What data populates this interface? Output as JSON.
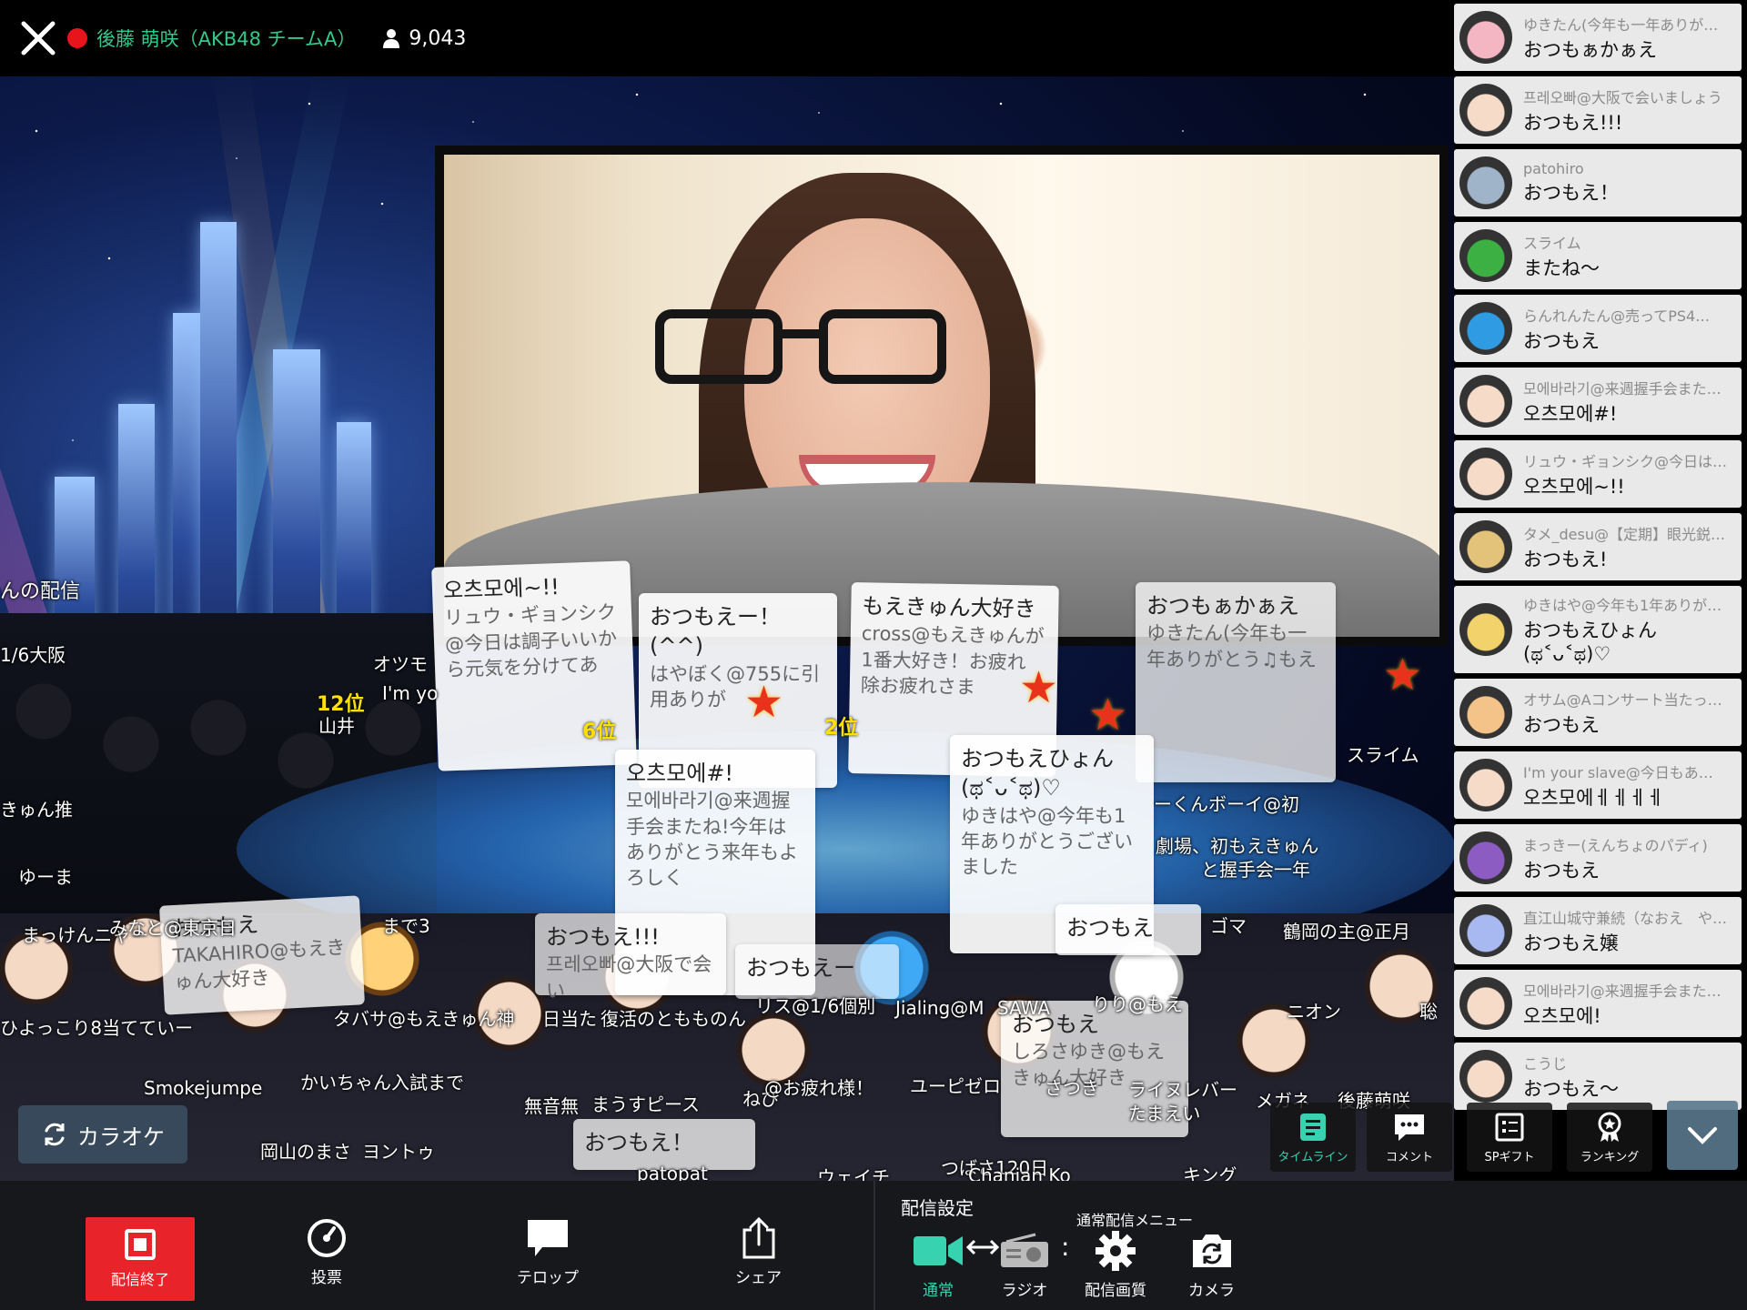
{
  "header": {
    "streamer_name": "後藤 萌咲（AKB48 チームA）",
    "viewer_count": "9,043"
  },
  "stage": {
    "cards": [
      {
        "title": "오츠모에~!!",
        "body": "リュウ・ギョンシク@今日は調子いいから元気を分けてあ"
      },
      {
        "title": "おつもえー！(^^)",
        "body": "はやぼく@755に引用ありが"
      },
      {
        "title": "もえきゅん大好き",
        "body": "cross@もえきゅんが1番大好き！お疲れ 除お疲れさま"
      },
      {
        "title": "おつもぁかぁえ",
        "body": "ゆきたん(今年も一年ありがとう♫もえ"
      },
      {
        "title": "오츠모에#!",
        "body": "모에바라기@来週握手会またね!今年はありがとう来年もよろしく"
      },
      {
        "title": "おつもえひょん(ಥ˂ᴗ˂ಥ)♡",
        "body": "ゆきはや@今年も1年ありがとうございました"
      },
      {
        "title": "おつもえ",
        "body": "TAKAHIRO@もえきゅん大好き"
      },
      {
        "title": "おつもえ!!!",
        "body": "프레오빠@大阪で会い"
      },
      {
        "title": "おつもえー",
        "body": ""
      },
      {
        "title": "おつもえ！",
        "body": ""
      },
      {
        "title": "おつもえ",
        "body": ""
      },
      {
        "title": "おつもえ",
        "body": "しろさゆき@もえきゅん大好き"
      }
    ],
    "ranks": [
      "12位",
      "6位",
      "2位"
    ],
    "floating": [
      "んの配信",
      "1/6大阪",
      "オツモ",
      "I'm yo",
      "山井",
      "ゆーま",
      "きゅん推",
      "まっけんニャー",
      "みなと@東京日",
      "まで3",
      "タバサ@もえきゅん神",
      "日当た",
      "復活のともものん",
      "リス@1/6個別",
      "Jialing@M",
      "SAWA",
      "りり@もえ",
      "Smokejumpe",
      "かいちゃん入試まで",
      "無音無",
      "まうすピース",
      "ねび",
      "@お疲れ様！",
      "ユーピ",
      "ゼロ",
      "さつき",
      "ライヌレバー",
      "たまえい",
      "メガネ",
      "後藤萌咲",
      "岡山のまさ",
      "ヨントゥ",
      "patopat",
      "ウェイチ",
      "つばさ120日",
      "Chanian Ko",
      "キング",
      "鶴岡の主@正月",
      "ニオン",
      "聡",
      "ゴマ",
      "劇場、初もえきゅん",
      "と握手会一年",
      "ーくんボーイ@初",
      "スライム",
      "ひよっこり8当てていー"
    ]
  },
  "chat": {
    "items": [
      {
        "user": "ゆきたん(今年も一年ありが…",
        "msg": "おつもぁかぁえ",
        "avatar_color": "#f4b6c2"
      },
      {
        "user": "프레오빠@大阪で会いましょう",
        "msg": "おつもえ!!!",
        "avatar_color": "#f6dcc8"
      },
      {
        "user": "patohiro",
        "msg": "おつもえ！",
        "avatar_color": "#9fb4c8"
      },
      {
        "user": "スライム",
        "msg": "またね〜",
        "avatar_color": "#3cb043"
      },
      {
        "user": "らんれんたん@売ってPS4…",
        "msg": "おつもえ",
        "avatar_color": "#2f9be3"
      },
      {
        "user": "모에바라기@来週握手会また…",
        "msg": "오츠모에#!",
        "avatar_color": "#f6dcc8"
      },
      {
        "user": "リュウ・ギョンシク@今日は…",
        "msg": "오츠모에~!!",
        "avatar_color": "#f6dcc8"
      },
      {
        "user": "タメ_desu@【定期】眼光鋭…",
        "msg": "おつもえ!",
        "avatar_color": "#e3c27a"
      },
      {
        "user": "ゆきはや@今年も1年ありが…",
        "msg": "おつもえひょん(ಥ˂ᴗ˂ಥ)♡",
        "avatar_color": "#f2d36b"
      },
      {
        "user": "オサム@Aコンサート当たっ…",
        "msg": "おつもえ",
        "avatar_color": "#f4c38a"
      },
      {
        "user": "I'm your slave@今日もあ…",
        "msg": "오츠모에ㅔㅔㅔㅔ",
        "avatar_color": "#f6dcc8"
      },
      {
        "user": "まっきー(えんちょのパディ)",
        "msg": "おつもえ",
        "avatar_color": "#8c5cc2"
      },
      {
        "user": "直江山城守兼続（なおえ　や…",
        "msg": "おつもえ嬢",
        "avatar_color": "#a8b8f0"
      },
      {
        "user": "모에바라기@来週握手会また…",
        "msg": "오츠모에!",
        "avatar_color": "#f6dcc8"
      },
      {
        "user": "こうじ",
        "msg": "おつもえ〜",
        "avatar_color": "#f6dcc8"
      }
    ]
  },
  "overlay": {
    "karaoke_label": "カラオケ",
    "timeline_label": "タイムライン",
    "comment_label": "コメント",
    "sp_gift_label": "SPギフト",
    "ranking_label": "ランキング"
  },
  "toolbar": {
    "end_label": "配信終了",
    "vote_label": "投票",
    "telop_label": "テロップ",
    "share_label": "シェア",
    "settings_title": "配信設定",
    "menu_title": "通常配信メニュー",
    "normal_label": "通常",
    "radio_label": "ラジオ",
    "quality_label": "配信画質",
    "camera_label": "カメラ"
  },
  "colors": {
    "live_red": "#e8141b",
    "name_green": "#34c98a",
    "accent_teal": "#37d3b0",
    "end_red": "#e8242a"
  }
}
